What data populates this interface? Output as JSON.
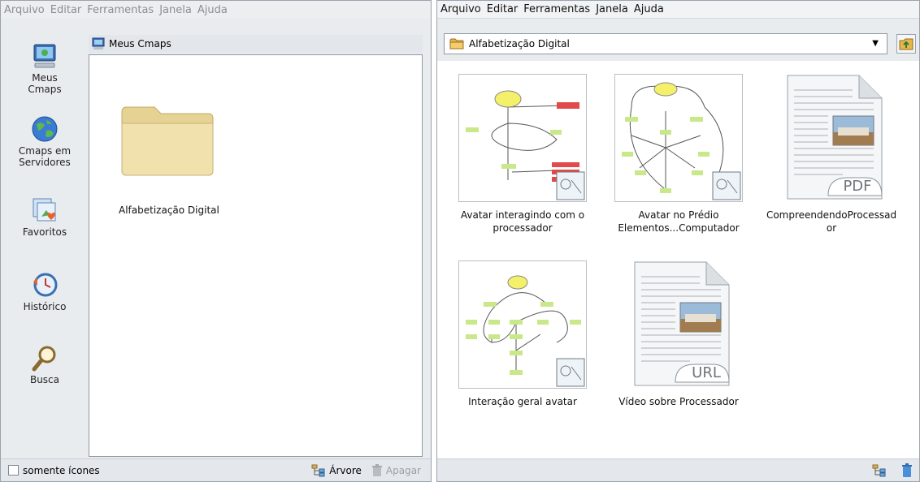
{
  "left_window": {
    "menu": [
      "Arquivo",
      "Editar",
      "Ferramentas",
      "Janela",
      "Ajuda"
    ],
    "sidebar": [
      {
        "label_line1": "Meus",
        "label_line2": "Cmaps",
        "icon": "monitor-icon"
      },
      {
        "label_line1": "Cmaps em",
        "label_line2": "Servidores",
        "icon": "globe-icon"
      },
      {
        "label_line1": "Favoritos",
        "label_line2": "",
        "icon": "favorites-icon"
      },
      {
        "label_line1": "Histórico",
        "label_line2": "",
        "icon": "history-icon"
      },
      {
        "label_line1": "Busca",
        "label_line2": "",
        "icon": "magnifier-icon"
      }
    ],
    "header_title": "Meus Cmaps",
    "folder_label": "Alfabetização Digital",
    "bottom": {
      "checkbox_label": "somente ícones",
      "tree_label": "Árvore",
      "delete_label": "Apagar"
    }
  },
  "right_window": {
    "menu": [
      "Arquivo",
      "Editar",
      "Ferramentas",
      "Janela",
      "Ajuda"
    ],
    "location": "Alfabetização Digital",
    "items": [
      {
        "label_line1": "Avatar interagindo com o",
        "label_line2": "processador",
        "kind": "cmap"
      },
      {
        "label_line1": "Avatar no Prédio",
        "label_line2": "Elementos...Computador",
        "kind": "cmap"
      },
      {
        "label_line1": "CompreendendoProcessad",
        "label_line2": "or",
        "kind": "pdf",
        "badge": "PDF"
      },
      {
        "label_line1": "Interação geral avatar",
        "label_line2": "",
        "kind": "cmap"
      },
      {
        "label_line1": "Vídeo sobre Processador",
        "label_line2": "",
        "kind": "url",
        "badge": "URL"
      }
    ]
  },
  "colors": {
    "window_bg": "#e9ecef",
    "folder": "#efdfa6",
    "node_yellow": "#f4f06a",
    "node_green": "#c9e88a",
    "node_red": "#e24a4a"
  }
}
